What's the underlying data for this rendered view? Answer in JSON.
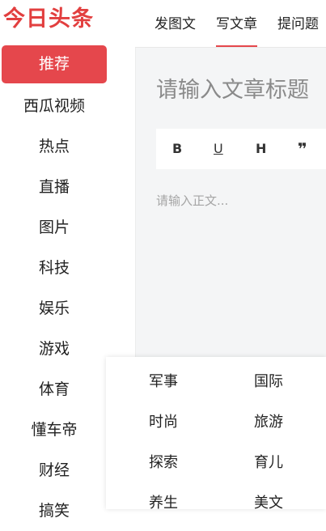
{
  "logo": "今日头条",
  "sidebar": {
    "items": [
      {
        "label": "推荐",
        "active": true
      },
      {
        "label": "西瓜视频"
      },
      {
        "label": "热点"
      },
      {
        "label": "直播"
      },
      {
        "label": "图片"
      },
      {
        "label": "科技"
      },
      {
        "label": "娱乐"
      },
      {
        "label": "游戏"
      },
      {
        "label": "体育"
      },
      {
        "label": "懂车帝"
      },
      {
        "label": "财经"
      },
      {
        "label": "搞笑"
      }
    ]
  },
  "tabs": [
    {
      "label": "发图文"
    },
    {
      "label": "写文章",
      "active": true
    },
    {
      "label": "提问题"
    }
  ],
  "editor": {
    "title_placeholder": "请输入文章标题",
    "body_placeholder": "请输入正文...",
    "toolbar": [
      "B",
      "U",
      "H",
      "❞"
    ]
  },
  "dropdown": {
    "items": [
      "军事",
      "国际",
      "时尚",
      "旅游",
      "探索",
      "育儿",
      "养生",
      "美文"
    ]
  },
  "colors": {
    "accent": "#e5474c",
    "logo": "#e23f3f",
    "editor_bg": "#f4f5f6"
  }
}
